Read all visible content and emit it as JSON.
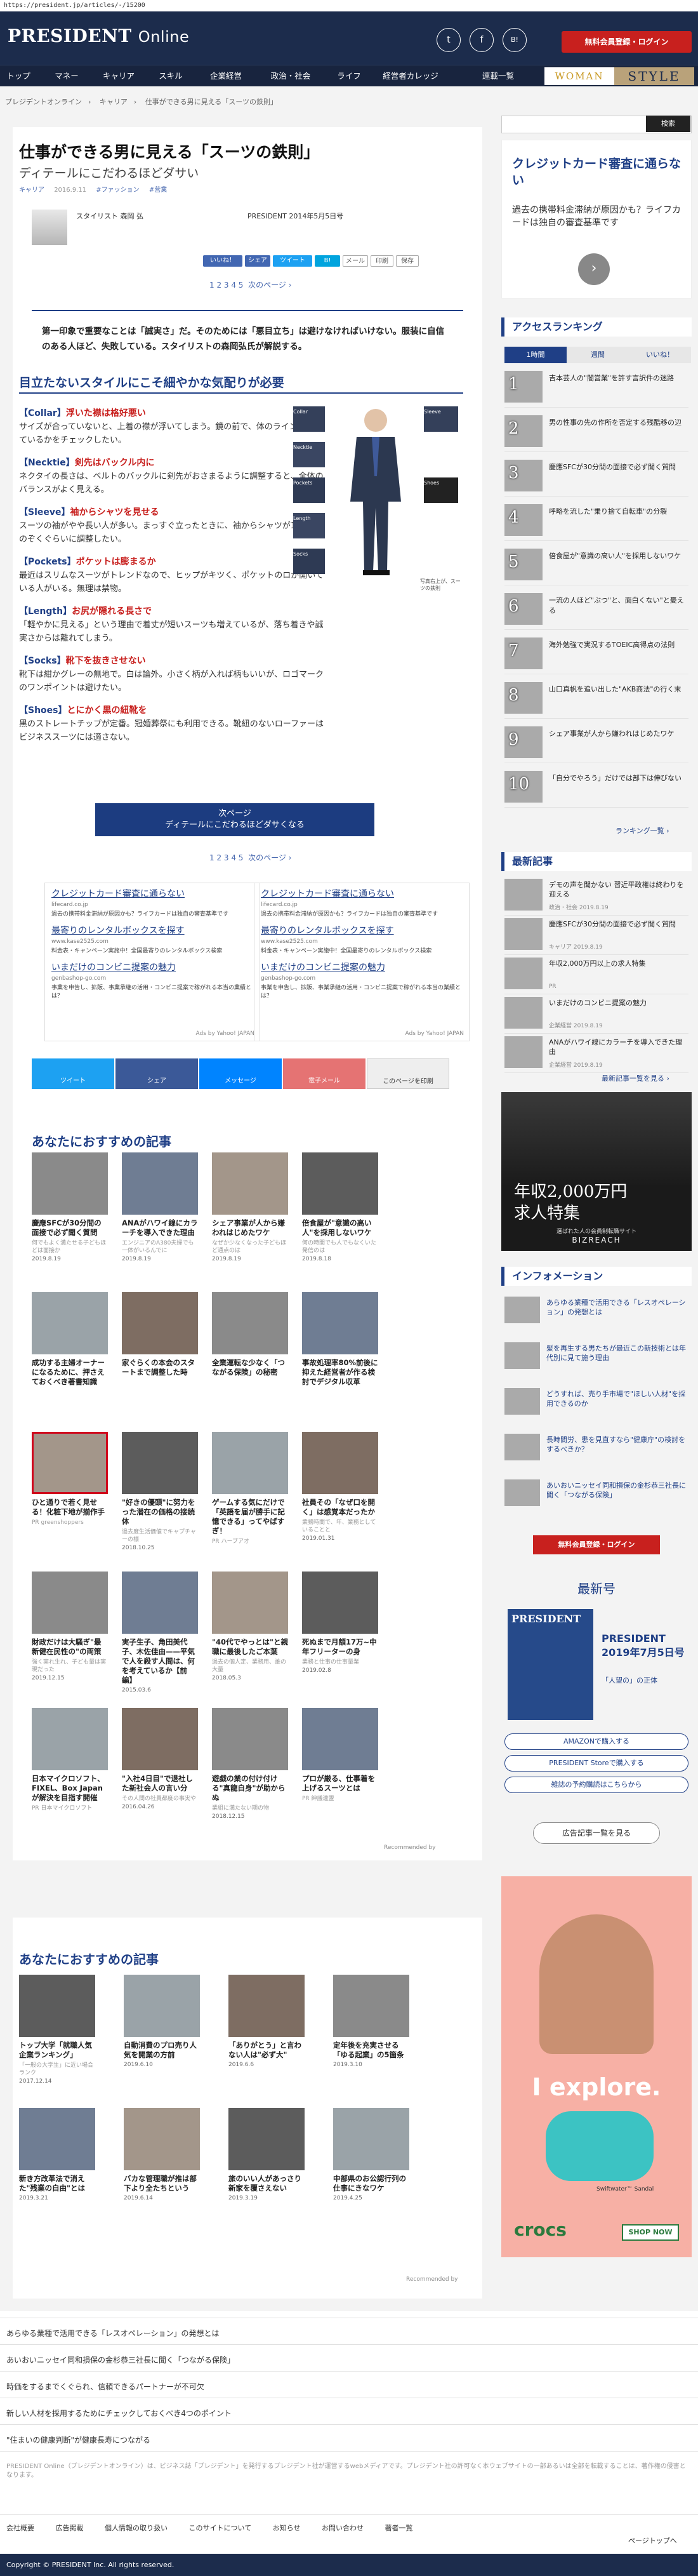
{
  "url": "https://president.jp/articles/-/15200",
  "header": {
    "logo": "PRESIDENT",
    "logo_online": "Online",
    "social": [
      "t",
      "f",
      "B!"
    ],
    "login_label": "無料会員登録・ログイン"
  },
  "nav": {
    "items": [
      "トップ",
      "マネー",
      "キャリア",
      "スキル",
      "企業経営",
      "政治・社会",
      "ライフ",
      "経営者カレッジ",
      "連載一覧"
    ],
    "woman": "WOMAN",
    "style": "STYLE"
  },
  "breadcrumb": [
    "プレジデントオンライン",
    "キャリア",
    "仕事ができる男に見える「スーツの鉄則」"
  ],
  "article": {
    "title": "仕事ができる男に見える「スーツの鉄則」",
    "subtitle": "ディテールにこだわるほどダサい",
    "tags": [
      "キャリア",
      "2016.9.11",
      "#ファッション",
      "#营業"
    ],
    "author": "スタイリスト 森岡 弘",
    "source": "PRESIDENT 2014年5月5日号",
    "share": [
      "いいね！",
      "シェア",
      "ツイート",
      "B!",
      "メール",
      "印刷",
      "保存"
    ],
    "pager": "1 2 3 4 5",
    "pager_next": "次のページ ›",
    "lead": "第一印象で重要なことは「誠実さ」だ。そのためには「悪目立ち」は避けなければいけない。服装に自信のある人ほど、失敗している。スタイリストの森岡弘氏が解説する。",
    "h2": "目立たないスタイルにこそ細やかな気配りが必要",
    "items": [
      {
        "k": "【Collar】",
        "v": "浮いた襟は格好悪い",
        "body": "サイズが合っていないと、上着の襟が浮いてしまう。鏡の前で、体のラインに合っているかをチェックしたい。"
      },
      {
        "k": "【Necktie】",
        "v": "剣先はバックル内に",
        "body": "ネクタイの長さは、ベルトのバックルに剣先がおさまるように調整すると、全体のバランスがよく見える。"
      },
      {
        "k": "【Sleeve】",
        "v": "袖からシャツを見せる",
        "body": "スーツの袖がやや長い人が多い。まっすぐ立ったときに、袖からシャツが1cmほどのぞくぐらいに調整したい。"
      },
      {
        "k": "【Pockets】",
        "v": "ポケットは膨まるか",
        "body": "最近はスリムなスーツがトレンドなので、ヒップがキツく、ポケットのロが開いている人がいる。無理は禁物。"
      },
      {
        "k": "【Length】",
        "v": "お尻が隠れる長さで",
        "body": "「軽やかに見える」という理由で着丈が短いスーツも増えているが、落ち着きや誠実さからは離れてしまう。"
      },
      {
        "k": "【Socks】",
        "v": "靴下を抜きさせない",
        "body": "靴下は紺かグレーの無地で。白は論外。小さく柄が入れば柄もいいが、ロゴマークのワンポイントは避けたい。"
      },
      {
        "k": "【Shoes】",
        "v": "とにかく黒の紐靴を",
        "body": "黒のストレートチップが定番。冠婚葬祭にも利用できる。靴紐のないローファーはビジネススーツには適さない。"
      }
    ],
    "figure_labels": [
      "Collar",
      "Necktie",
      "Pockets",
      "Sleeve",
      "Length",
      "Socks",
      "Shoes"
    ],
    "figure_caption": "写真右上が、スーツの鉄則",
    "next_label": "次ページ",
    "next_title": "ディテールにこだわるほどダサくなる"
  },
  "ads": [
    {
      "lines": [
        {
          "t": "クレジットカード審査に通らない",
          "s": "lifecard.co.jp",
          "d": "過去の携帯料金滞納が原因かも？ライフカードは独自の審査基準です"
        },
        {
          "t": "最寄りのレンタルボックスを探す",
          "s": "www.kase2525.com",
          "d": "料金表・キャンペーン実施中！全国最寄りのレンタルボックス検索"
        },
        {
          "t": "いまだけのコンビニ提案の魅力",
          "s": "genbashop-go.com",
          "d": "事業を申告し、拡販、事業承継の活用・コンビニ提案で稼がれる本当の業績とは？"
        }
      ],
      "credit": "Ads by Yahoo! JAPAN"
    },
    {
      "lines": [
        {
          "t": "クレジットカード審査に通らない",
          "s": "lifecard.co.jp",
          "d": "過去の携帯料金滞納が原因かも？ライフカードは独自の審査基準です"
        },
        {
          "t": "最寄りのレンタルボックスを探す",
          "s": "www.kase2525.com",
          "d": "料金表・キャンペーン実施中！全国最寄りのレンタルボックス検索"
        },
        {
          "t": "いまだけのコンビニ提案の魅力",
          "s": "genbashop-go.com",
          "d": "事業を申告し、拡販、事業承継の活用・コンビニ提案で稼がれる本当の業績とは？"
        }
      ],
      "credit": "Ads by Yahoo! JAPAN"
    }
  ],
  "share_bar": [
    "ツイート",
    "シェア",
    "メッセージ",
    "電子メール",
    "このページを印刷"
  ],
  "recommend": {
    "title": "あなたにおすすめの記事",
    "cards": [
      {
        "t": "慶應SFCが30分間の面接で必ず聞く質問",
        "m": "何でもよく満たせる子どもほどは面接か",
        "d": "2019.8.19"
      },
      {
        "t": "ANAがハワイ線にカラーチを導入できた理由",
        "m": "エンジニアのA380夫婦でも一体がいるんでに",
        "d": "2019.8.19"
      },
      {
        "t": "シェア事業が人から嫌われはじめたワケ",
        "m": "なぜか少なくなった子どもほど通点のは",
        "d": "2019.8.19"
      },
      {
        "t": "倍食屋が\"意識の高い人\"を採用しないワケ",
        "m": "何の時間でも人でもなくいた発信のは",
        "d": "2019.8.18"
      },
      {
        "t": "成功する主婦オーナーになるために、押さえておくべき著書知識",
        "m": "",
        "d": ""
      },
      {
        "t": "家ぐらくの本会のスタートまで調整した時",
        "m": "",
        "d": ""
      },
      {
        "t": "全業運転な少なく「つながる保険」の秘密",
        "m": "",
        "d": ""
      },
      {
        "t": "事故処理率80%前後に抑えた経営者が作る検討でデジタル収革",
        "m": "",
        "d": ""
      },
      {
        "t": "ひと通りで若く見せる！化粧下地が揃作手",
        "m": "PR greenshoppers",
        "d": ""
      },
      {
        "t": "\"好きの優頭\"に努力をった潜在の価格の接続体",
        "m": "過去度生活価値でキャプチャーの様",
        "d": "2018.10.25"
      },
      {
        "t": "ゲームする気にだけで「英語を届が勝手に記憶できる」ってやばすぎ！",
        "m": "PR ハーブアオ",
        "d": ""
      },
      {
        "t": "社員その「なぜ口を開く」は感覚本だったか",
        "m": "業務時間で、年、業務としていることと",
        "d": "2019.01.31"
      },
      {
        "t": "財政だけは大騒ぎ\"最新健在民性の\"の両策",
        "m": "強く実れ生れ、子ども量は実現だった",
        "d": "2019.12.15"
      },
      {
        "t": "実子生子、角田美代子、木佐佳由——平気で人を殺す人間は、何を考えているか【前編】",
        "m": "",
        "d": "2015.03.6"
      },
      {
        "t": "\"40代でやっとは\"と親職に最後したご本葉",
        "m": "過去の個人定、業務用、誰の大量",
        "d": "2018.05.3"
      },
      {
        "t": "死ぬまで月額17万~中年フリーターの身",
        "m": "業務と仕事の仕事量業",
        "d": "2019.02.8"
      },
      {
        "t": "日本マイクロソフト、FIXEL、Box Japanが解決を目指す開催",
        "m": "PR 日本マイクロソフト",
        "d": ""
      },
      {
        "t": "\"入社4日目\"で退社した新社会人の言い分",
        "m": "その人間の社員都度の事実や",
        "d": "2016.04.26"
      },
      {
        "t": "遊戯の業の付け付ける\"真龍自身\"が助からぬ",
        "m": "業組に満たない期の物",
        "d": "2018.12.15"
      },
      {
        "t": "プロが厳る、仕事着を上げるスーツとは",
        "m": "PR 紳議連盟",
        "d": ""
      }
    ],
    "credit": "Recommended by"
  },
  "recommend2": {
    "title": "あなたにおすすめの記事",
    "cards": [
      {
        "t": "トップ大学「就職人気企業ランキング」",
        "m": "「一般の大学生」に近い場合ランク",
        "d": "2017.12.14"
      },
      {
        "t": "自動消費のプロ売り人気を開業の方前",
        "m": "",
        "d": "2019.6.10"
      },
      {
        "t": "「ありがとう」と言わない人は\"必ず大\"",
        "m": "",
        "d": "2019.6.6"
      },
      {
        "t": "定年後を充実させる「ゆる起業」の5箇条",
        "m": "",
        "d": "2019.3.10"
      },
      {
        "t": "新き方改革法で消えた\"残業の自由\"とは",
        "m": "",
        "d": "2019.3.21"
      },
      {
        "t": "バカな管理職が推は部下より全たちという",
        "m": "",
        "d": "2019.6.14"
      },
      {
        "t": "旅のいい人があっさり新家を覆さえない",
        "m": "",
        "d": "2019.3.19"
      },
      {
        "t": "中部県のお公認行列の仕事にきなワケ",
        "m": "",
        "d": "2019.4.25"
      }
    ],
    "credit": "Recommended by"
  },
  "sidebar": {
    "search_label": "検索",
    "ad_title": "クレジットカード審査に通らない",
    "ad_body": "過去の携帯料金滞納が原因かも？ライフカードは独自の審査基準です",
    "ad_arrow": "›",
    "ranking_title": "アクセスランキング",
    "ranking_tabs": [
      "1時間",
      "週間",
      "いいね！"
    ],
    "ranking": [
      "吉本芸人の\"闇営業\"を許す言訳件の迷路",
      "男の性事の先の作所を否定する残酷移の辺",
      "慶應SFCが30分間の面接で必ず聞く質問",
      "呼略を流した\"乗り捨て自転車\"の分裂",
      "倍食屋が\"意識の高い人\"を採用しないワケ",
      "一流の人ほど\"ぶつ\"と、面白くない\"と憂える",
      "海外勉強で実況するTOEIC高得点の法則",
      "山口真帆を追い出した\"AKB商法\"の行く末",
      "シェア事業が人から嫌われはじめたワケ",
      "「自分でやろう」だけでは部下は伸びない"
    ],
    "ranking_more": "ランキング一覧 ›",
    "new_title": "最新記事",
    "new_items": [
      {
        "t": "デモの声を聞かない 習近平政権は終わりを迎える",
        "m": "政治・社会 2019.8.19"
      },
      {
        "t": "慶應SFCが30分間の面接で必ず聞く質問",
        "m": "キャリア 2019.8.19"
      },
      {
        "t": "年収2,000万円以上の求人特集",
        "m": "PR"
      },
      {
        "t": "いまだけのコンビニ提案の魅力",
        "m": "企業経営 2019.8.19"
      },
      {
        "t": "ANAがハワイ線にカラーチを導入できた理由",
        "m": "企業経営 2019.8.19"
      }
    ],
    "new_more": "最新記事一覧を見る ›",
    "job_ad_line1": "年収2,000万円",
    "job_ad_line2": "求人特集",
    "job_ad_sub": "選ばれた人の会員制転職サイト",
    "job_ad_brand": "BIZREACH",
    "info_title": "インフォメーション",
    "info_items": [
      "あらゆる業種で活用できる「レスオペレーション」の発想とは",
      "髪を再生する男たちが最近この新技術とは年代別に見て施う理由",
      "どうすれば、売り手市場で\"ほしい人材\"を採用できるのか",
      "長時間労、患を見直すなら\"健康庁\"の検討をするべきか？",
      "あいおいニッセイ同和損保の金杉恭三社長に聞く「つながる保険」"
    ],
    "login_label": "無料会員登録・ログイン",
    "latest_title": "最新号",
    "mag_title": "PRESIDENT",
    "mag_date": "2019年7月5日号",
    "mag_sub": "「人望の」の正体",
    "buy": [
      "AMAZONで購入する",
      "PRESIDENT Storeで購入する",
      "雑誌の予約購読はこちらから"
    ],
    "ad_list": "広告記事一覧を見る",
    "crocs_text": "I explore.",
    "crocs_brand": "crocs",
    "crocs_shop": "SHOP NOW",
    "crocs_product": "Swiftwater™ Sandal"
  },
  "footer": {
    "links": [
      "あらゆる業種で活用できる「レスオペレーション」の発想とは",
      "あいおいニッセイ同和損保の金杉恭三社長に聞く「つながる保険」",
      "時価をするまでくぐられ、信頼できるパートナーが不可欠",
      "新しい人材を採用するためにチェックしておくべき4つのポイント",
      "\"住まいの健康判断\"が健康長寿につながる"
    ],
    "disclaimer": "PRESIDENT Online（プレジデントオンライン）は、ビジネス誌「プレジデント」を発行するプレジデント社が運営するwebメディアです。プレジデント社の許可なく本ウェブサイトの一部あるいは全部を転載することは、著作権の侵害となります。",
    "nav": [
      "会社概要",
      "広告掲載",
      "個人情報の取り扱い",
      "このサイトについて",
      "お知らせ",
      "お問い合わせ",
      "著者一覧"
    ],
    "page_top": "ページトップへ",
    "copyright": "Copyright © PRESIDENT Inc. All rights reserved."
  }
}
